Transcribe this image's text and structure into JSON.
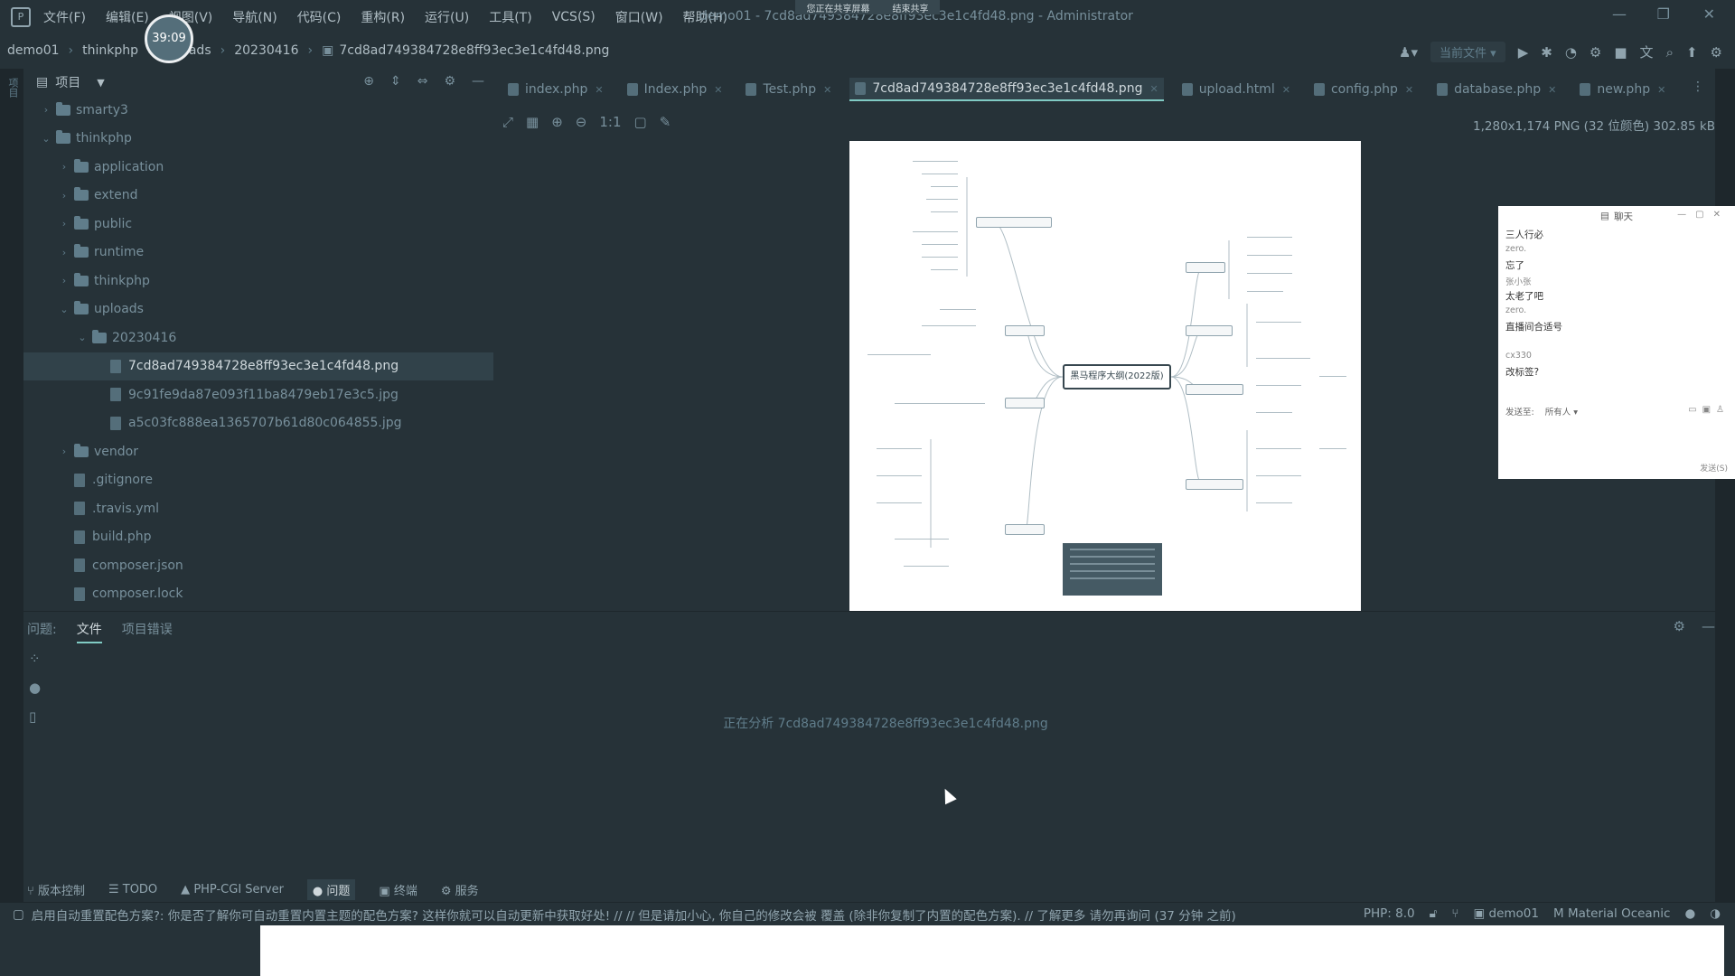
{
  "menubar": {
    "items": [
      "文件(F)",
      "编辑(E)",
      "视图(V)",
      "导航(N)",
      "代码(C)",
      "重构(R)",
      "运行(U)",
      "工具(T)",
      "VCS(S)",
      "窗口(W)",
      "帮助(H)"
    ],
    "window_title": "demo01 - 7cd8ad749384728e8ff93ec3e1c4fd48.png - Administrator",
    "share_left": "您正在共享屏幕",
    "share_right": "结束共享"
  },
  "timer": "39:09",
  "breadcrumb": [
    "demo01",
    "thinkphp",
    "uploads",
    "20230416",
    "7cd8ad749384728e8ff93ec3e1c4fd48.png"
  ],
  "topright": {
    "run_config": "当前文件"
  },
  "project": {
    "title": "项目",
    "tree": [
      {
        "label": "smarty3",
        "indent": 0,
        "type": "folder",
        "chev": "›"
      },
      {
        "label": "thinkphp",
        "indent": 0,
        "type": "folder",
        "chev": "⌄"
      },
      {
        "label": "application",
        "indent": 1,
        "type": "folder",
        "chev": "›"
      },
      {
        "label": "extend",
        "indent": 1,
        "type": "folder",
        "chev": "›"
      },
      {
        "label": "public",
        "indent": 1,
        "type": "folder",
        "chev": "›"
      },
      {
        "label": "runtime",
        "indent": 1,
        "type": "folder",
        "chev": "›"
      },
      {
        "label": "thinkphp",
        "indent": 1,
        "type": "folder",
        "chev": "›"
      },
      {
        "label": "uploads",
        "indent": 1,
        "type": "folder",
        "chev": "⌄"
      },
      {
        "label": "20230416",
        "indent": 2,
        "type": "folder",
        "chev": "⌄"
      },
      {
        "label": "7cd8ad749384728e8ff93ec3e1c4fd48.png",
        "indent": 3,
        "type": "file",
        "chev": "",
        "selected": true
      },
      {
        "label": "9c91fe9da87e093f11ba8479eb17e3c5.jpg",
        "indent": 3,
        "type": "file",
        "chev": ""
      },
      {
        "label": "a5c03fc888ea1365707b61d80c064855.jpg",
        "indent": 3,
        "type": "file",
        "chev": ""
      },
      {
        "label": "vendor",
        "indent": 1,
        "type": "folder",
        "chev": "›"
      },
      {
        "label": ".gitignore",
        "indent": 1,
        "type": "file",
        "chev": ""
      },
      {
        "label": ".travis.yml",
        "indent": 1,
        "type": "file",
        "chev": ""
      },
      {
        "label": "build.php",
        "indent": 1,
        "type": "file",
        "chev": ""
      },
      {
        "label": "composer.json",
        "indent": 1,
        "type": "file",
        "chev": ""
      },
      {
        "label": "composer.lock",
        "indent": 1,
        "type": "file",
        "chev": ""
      }
    ]
  },
  "tabs": [
    {
      "label": "index.php",
      "active": false
    },
    {
      "label": "Index.php",
      "active": false
    },
    {
      "label": "Test.php",
      "active": false
    },
    {
      "label": "7cd8ad749384728e8ff93ec3e1c4fd48.png",
      "active": true
    },
    {
      "label": "upload.html",
      "active": false
    },
    {
      "label": "config.php",
      "active": false
    },
    {
      "label": "database.php",
      "active": false
    },
    {
      "label": "new.php",
      "active": false
    }
  ],
  "image_info": "1,280x1,174 PNG (32 位颜色) 302.85 kB",
  "mindmap": {
    "center": "黑马程序大纲(2022版)"
  },
  "chat": {
    "title": "聊天",
    "lines": [
      {
        "text": "三人行必",
        "meta": false
      },
      {
        "text": "zero.",
        "meta": true
      },
      {
        "text": "忘了",
        "meta": false
      },
      {
        "text": "张小张",
        "meta": true
      },
      {
        "text": "太老了吧",
        "meta": false
      },
      {
        "text": "zero.",
        "meta": true
      },
      {
        "text": "直播间合适号",
        "meta": false
      },
      {
        "text": "",
        "meta": true
      },
      {
        "text": "cx330",
        "meta": true
      },
      {
        "text": "改标签?",
        "meta": false
      }
    ],
    "send_to_label": "发送至:",
    "send_to_value": "所有人",
    "send_button": "发送(S)"
  },
  "problems": {
    "tabs": [
      "问题:",
      "文件",
      "项目错误"
    ],
    "analyzing": "正在分析 7cd8ad749384728e8ff93ec3e1c4fd48.png"
  },
  "toolwindows": [
    "版本控制",
    "TODO",
    "PHP-CGI Server",
    "问题",
    "终端",
    "服务"
  ],
  "status": {
    "message": "启用自动重置配色方案?: 你是否了解你可自动重置内置主题的配色方案? 这样你就可以自动更新中获取好处! // // 但是请加小心, 你自己的修改会被 覆盖 (除非你复制了内置的配色方案). // 了解更多  请勿再询问 (37 分钟 之前)",
    "php": "PHP: 8.0",
    "project": "demo01",
    "theme": "Material Oceanic"
  }
}
